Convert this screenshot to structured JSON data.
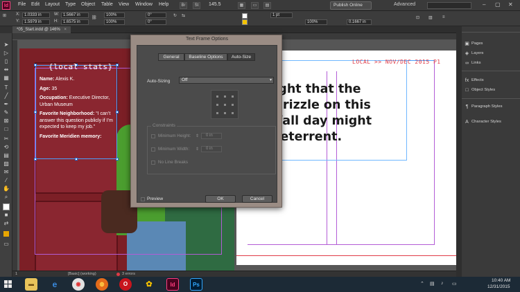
{
  "app": {
    "logo": "Id"
  },
  "menu": [
    "File",
    "Edit",
    "Layout",
    "Type",
    "Object",
    "Table",
    "View",
    "Window",
    "Help"
  ],
  "menubar": {
    "br_label": "Br",
    "st_label": "St",
    "zoom": "145.5",
    "publish_label": "Publish Online",
    "workspace": "Advanced"
  },
  "controlbar": {
    "x_label": "X:",
    "x_value": "1.0333 in",
    "y_label": "Y:",
    "y_value": "1.5979 in",
    "w_label": "W:",
    "w_value": "1.5667 in",
    "h_label": "H:",
    "h_value": "1.6575 in",
    "scale_x": "100%",
    "scale_y": "100%",
    "angle": "0°",
    "shear": "0°",
    "stroke_weight": "1 pt",
    "opacity": "100%",
    "frame_offset": "0.1667 in"
  },
  "document_tab": {
    "title": "*05_Start.indd @ 146%",
    "close": "×"
  },
  "page": {
    "folio": "LOCAL >> NOV/DEC 2015  P1",
    "quote_lines": [
      "thought that the",
      "ght drizzle on this",
      "risp fall day might",
      "e a deterrent."
    ]
  },
  "stats": {
    "title": "{local stats}",
    "name_label": "Name:",
    "name_value": "Alexis K.",
    "age_label": "Age:",
    "age_value": "35",
    "occupation_label": "Occupation:",
    "occupation_value": "Executive Director, Urban Museum",
    "neighborhood_label": "Favorite Neighborhood:",
    "neighborhood_value": "“I can’t answer this question publicly if I’m expected to keep my job.”",
    "memory_label": "Favorite Meridien memory:"
  },
  "dialog": {
    "title": "Text Frame Options",
    "tabs": [
      "General",
      "Baseline Options",
      "Auto-Size"
    ],
    "active_tab": "Auto-Size",
    "autosizing_label": "Auto-Sizing",
    "autosizing_value": "Off",
    "constraints_label": "Constraints",
    "min_height_label": "Minimum Height:",
    "min_height_value": "0 in",
    "min_width_label": "Minimum Width:",
    "min_width_value": "0 in",
    "no_line_breaks_label": "No Line Breaks",
    "preview_label": "Preview",
    "ok_label": "OK",
    "cancel_label": "Cancel"
  },
  "panels": [
    {
      "label": "Pages",
      "icon": "pages-icon",
      "glyph": "▣"
    },
    {
      "label": "Layers",
      "icon": "layers-icon",
      "glyph": "◈"
    },
    {
      "label": "Links",
      "icon": "links-icon",
      "glyph": "∞"
    },
    {
      "label": "Effects",
      "icon": "effects-icon",
      "glyph": "fx"
    },
    {
      "label": "Object Styles",
      "icon": "object-styles-icon",
      "glyph": "□"
    },
    {
      "label": "Paragraph Styles",
      "icon": "paragraph-styles-icon",
      "glyph": "¶"
    },
    {
      "label": "Character Styles",
      "icon": "character-styles-icon",
      "glyph": "A"
    }
  ],
  "statusbar": {
    "page_num": "1",
    "style": "[Basic] (working)",
    "errors": "3 errors"
  },
  "taskbar": {
    "time": "10:40 AM",
    "date": "12/31/2015",
    "indesign_label": "Id",
    "photoshop_label": "Ps"
  },
  "colors": {
    "accent_red": "#e03a46",
    "indesign_pink": "#ff3d7f",
    "frame_blue": "#4aa0ff",
    "guide_magenta": "#b35cd6"
  }
}
